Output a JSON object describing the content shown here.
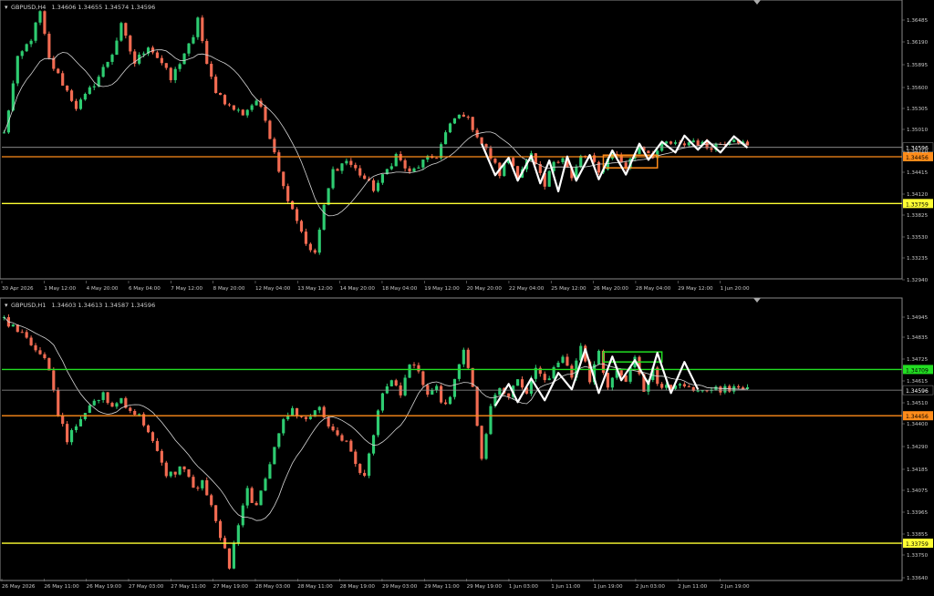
{
  "colors": {
    "background": "#000000",
    "bull": "#2ecc71",
    "bear": "#f26b52",
    "ma": "#d6d6d6",
    "axis_text": "#c8c8c8",
    "orange": "#ff8c1a",
    "yellow": "#ffff33",
    "green": "#22dd22",
    "zigzag": "#ffffff"
  },
  "chart_data": [
    {
      "type": "candlestick",
      "symbol_title": "GBPUSD,H4",
      "ohlc_text": "1.34606 1.34655 1.34574 1.34596",
      "ylim": [
        1.328,
        1.366
      ],
      "y_ticks": [
        "1.36485",
        "1.36190",
        "1.35895",
        "1.35600",
        "1.35305",
        "1.35010",
        "1.34710",
        "1.34415",
        "1.34120",
        "1.33825",
        "1.33530",
        "1.33235",
        "1.32940"
      ],
      "x_ticks": [
        "30 Apr 2026",
        "1 May 12:00",
        "4 May 20:00",
        "6 May 04:00",
        "7 May 12:00",
        "8 May 20:00",
        "12 May 04:00",
        "13 May 12:00",
        "14 May 20:00",
        "18 May 04:00",
        "19 May 12:00",
        "20 May 20:00",
        "22 May 04:00",
        "25 May 12:00",
        "26 May 20:00",
        "28 May 04:00",
        "29 May 12:00",
        "1 Jun 20:00"
      ],
      "levels": [
        {
          "label": "1.34456",
          "value": 1.34456,
          "color": "#ff8c1a"
        },
        {
          "label": "1.33759",
          "value": 1.33759,
          "color": "#ffff33"
        }
      ],
      "current_price": {
        "label": "1.34596",
        "value": 1.34596
      },
      "rectangle": {
        "t0": 133,
        "t1": 145,
        "p_top": 1.3448,
        "p_bottom": 1.3429,
        "color": "#ff8c1a"
      },
      "zigzag": [
        {
          "t": 106,
          "p": 1.3465
        },
        {
          "t": 109,
          "p": 1.3418
        },
        {
          "t": 112,
          "p": 1.3444
        },
        {
          "t": 114,
          "p": 1.341
        },
        {
          "t": 117,
          "p": 1.3447
        },
        {
          "t": 119,
          "p": 1.3406
        },
        {
          "t": 121,
          "p": 1.344
        },
        {
          "t": 123,
          "p": 1.3394
        },
        {
          "t": 125,
          "p": 1.3446
        },
        {
          "t": 127,
          "p": 1.341
        },
        {
          "t": 130,
          "p": 1.3448
        },
        {
          "t": 132,
          "p": 1.3412
        },
        {
          "t": 135,
          "p": 1.3455
        },
        {
          "t": 138,
          "p": 1.3419
        },
        {
          "t": 141,
          "p": 1.3465
        },
        {
          "t": 143,
          "p": 1.3441
        },
        {
          "t": 146,
          "p": 1.3468
        },
        {
          "t": 149,
          "p": 1.3452
        },
        {
          "t": 151,
          "p": 1.3477
        },
        {
          "t": 154,
          "p": 1.3456
        },
        {
          "t": 156,
          "p": 1.347
        },
        {
          "t": 159,
          "p": 1.3452
        },
        {
          "t": 162,
          "p": 1.3476
        },
        {
          "t": 165,
          "p": 1.3459
        }
      ],
      "waypoints": [
        [
          0,
          1.348
        ],
        [
          3,
          1.359
        ],
        [
          6,
          1.3622
        ],
        [
          8,
          1.366
        ],
        [
          10,
          1.359
        ],
        [
          13,
          1.3555
        ],
        [
          16,
          1.352
        ],
        [
          18,
          1.3535
        ],
        [
          21,
          1.3565
        ],
        [
          24,
          1.36
        ],
        [
          26,
          1.364
        ],
        [
          29,
          1.3585
        ],
        [
          32,
          1.3612
        ],
        [
          35,
          1.3585
        ],
        [
          37,
          1.356
        ],
        [
          40,
          1.36
        ],
        [
          42,
          1.362
        ],
        [
          43,
          1.3655
        ],
        [
          45,
          1.358
        ],
        [
          47,
          1.3545
        ],
        [
          50,
          1.352
        ],
        [
          53,
          1.351
        ],
        [
          56,
          1.353
        ],
        [
          58,
          1.35
        ],
        [
          60,
          1.3455
        ],
        [
          62,
          1.34
        ],
        [
          64,
          1.337
        ],
        [
          66,
          1.3335
        ],
        [
          68,
          1.3303
        ],
        [
          69,
          1.3303
        ],
        [
          71,
          1.337
        ],
        [
          73,
          1.3425
        ],
        [
          76,
          1.344
        ],
        [
          79,
          1.342
        ],
        [
          82,
          1.3398
        ],
        [
          84,
          1.3415
        ],
        [
          87,
          1.3448
        ],
        [
          90,
          1.342
        ],
        [
          93,
          1.3438
        ],
        [
          96,
          1.3447
        ],
        [
          98,
          1.348
        ],
        [
          100,
          1.3502
        ],
        [
          102,
          1.351
        ],
        [
          104,
          1.349
        ],
        [
          106,
          1.3465
        ],
        [
          108,
          1.3445
        ],
        [
          110,
          1.342
        ],
        [
          112,
          1.3445
        ],
        [
          114,
          1.342
        ],
        [
          117,
          1.3447
        ],
        [
          120,
          1.34
        ],
        [
          122,
          1.344
        ],
        [
          124,
          1.3446
        ],
        [
          126,
          1.3412
        ],
        [
          128,
          1.3445
        ],
        [
          130,
          1.3446
        ],
        [
          132,
          1.342
        ],
        [
          135,
          1.3453
        ],
        [
          138,
          1.343
        ],
        [
          141,
          1.3462
        ],
        [
          144,
          1.3448
        ],
        [
          147,
          1.3466
        ],
        [
          150,
          1.3462
        ],
        [
          153,
          1.347
        ],
        [
          156,
          1.346
        ],
        [
          159,
          1.3465
        ],
        [
          162,
          1.3475
        ],
        [
          165,
          1.346
        ]
      ]
    },
    {
      "type": "candlestick",
      "symbol_title": "GBPUSD,H1",
      "ohlc_text": "1.34603 1.34613 1.34587 1.34596",
      "ylim": [
        1.3357,
        1.3503
      ],
      "y_ticks": [
        "1.34945",
        "1.34835",
        "1.34725",
        "1.34615",
        "1.34510",
        "1.34400",
        "1.34290",
        "1.34185",
        "1.34075",
        "1.33965",
        "1.33855",
        "1.33750",
        "1.33640"
      ],
      "x_ticks": [
        "26 May 2026",
        "26 May 11:00",
        "26 May 19:00",
        "27 May 03:00",
        "27 May 11:00",
        "27 May 19:00",
        "28 May 03:00",
        "28 May 11:00",
        "28 May 19:00",
        "29 May 03:00",
        "29 May 11:00",
        "29 May 19:00",
        "1 Jun 03:00",
        "1 Jun 11:00",
        "1 Jun 19:00",
        "2 Jun 03:00",
        "2 Jun 11:00",
        "2 Jun 19:00"
      ],
      "levels": [
        {
          "label": "1.34709",
          "value": 1.34709,
          "color": "#22dd22"
        },
        {
          "label": "1.34456",
          "value": 1.34456,
          "color": "#ff8c1a"
        },
        {
          "label": "1.33759",
          "value": 1.33759,
          "color": "#ffff33"
        }
      ],
      "current_price": {
        "label": "1.34596",
        "value": 1.34596
      },
      "rectangle": {
        "t0": 133,
        "t1": 146,
        "p_top": 1.34805,
        "p_bottom": 1.3475,
        "color": "#22dd22"
      },
      "zigzag": [
        {
          "t": 109,
          "p": 1.3451
        },
        {
          "t": 112,
          "p": 1.3463
        },
        {
          "t": 114,
          "p": 1.3453
        },
        {
          "t": 117,
          "p": 1.3466
        },
        {
          "t": 120,
          "p": 1.3454
        },
        {
          "t": 123,
          "p": 1.3469
        },
        {
          "t": 126,
          "p": 1.346
        },
        {
          "t": 129,
          "p": 1.3482
        },
        {
          "t": 132,
          "p": 1.3458
        },
        {
          "t": 135,
          "p": 1.3478
        },
        {
          "t": 137,
          "p": 1.3465
        },
        {
          "t": 140,
          "p": 1.3476
        },
        {
          "t": 143,
          "p": 1.3463
        },
        {
          "t": 145,
          "p": 1.348
        },
        {
          "t": 148,
          "p": 1.3458
        },
        {
          "t": 151,
          "p": 1.3475
        },
        {
          "t": 154,
          "p": 1.346
        }
      ],
      "waypoints": [
        [
          0,
          1.3498
        ],
        [
          4,
          1.3492
        ],
        [
          8,
          1.348
        ],
        [
          10,
          1.347
        ],
        [
          12,
          1.3446
        ],
        [
          14,
          1.3433
        ],
        [
          16,
          1.344
        ],
        [
          18,
          1.3448
        ],
        [
          20,
          1.3452
        ],
        [
          22,
          1.3458
        ],
        [
          24,
          1.345
        ],
        [
          26,
          1.3455
        ],
        [
          28,
          1.3449
        ],
        [
          30,
          1.3445
        ],
        [
          32,
          1.3438
        ],
        [
          34,
          1.3425
        ],
        [
          36,
          1.3412
        ],
        [
          38,
          1.3415
        ],
        [
          40,
          1.3418
        ],
        [
          42,
          1.3405
        ],
        [
          44,
          1.341
        ],
        [
          46,
          1.3395
        ],
        [
          48,
          1.338
        ],
        [
          50,
          1.3363
        ],
        [
          52,
          1.3385
        ],
        [
          54,
          1.3405
        ],
        [
          56,
          1.3395
        ],
        [
          58,
          1.341
        ],
        [
          60,
          1.343
        ],
        [
          62,
          1.3445
        ],
        [
          64,
          1.3448
        ],
        [
          66,
          1.3444
        ],
        [
          68,
          1.3446
        ],
        [
          70,
          1.345
        ],
        [
          72,
          1.344
        ],
        [
          74,
          1.3436
        ],
        [
          76,
          1.343
        ],
        [
          78,
          1.342
        ],
        [
          80,
          1.3412
        ],
        [
          82,
          1.3435
        ],
        [
          84,
          1.346
        ],
        [
          86,
          1.3465
        ],
        [
          88,
          1.3455
        ],
        [
          90,
          1.3475
        ],
        [
          92,
          1.347
        ],
        [
          94,
          1.3455
        ],
        [
          96,
          1.346
        ],
        [
          98,
          1.345
        ],
        [
          100,
          1.3465
        ],
        [
          102,
          1.348
        ],
        [
          104,
          1.3462
        ],
        [
          106,
          1.342
        ],
        [
          108,
          1.345
        ],
        [
          110,
          1.3462
        ],
        [
          112,
          1.3455
        ],
        [
          114,
          1.3465
        ],
        [
          116,
          1.3458
        ],
        [
          118,
          1.347
        ],
        [
          120,
          1.3465
        ],
        [
          122,
          1.347
        ],
        [
          124,
          1.3478
        ],
        [
          126,
          1.3468
        ],
        [
          128,
          1.3482
        ],
        [
          130,
          1.3465
        ],
        [
          132,
          1.348
        ],
        [
          134,
          1.3462
        ],
        [
          136,
          1.347
        ],
        [
          138,
          1.3466
        ],
        [
          140,
          1.3478
        ],
        [
          142,
          1.346
        ],
        [
          144,
          1.347
        ],
        [
          146,
          1.346
        ],
        [
          148,
          1.3462
        ],
        [
          150,
          1.3461
        ],
        [
          152,
          1.346
        ],
        [
          154,
          1.346
        ]
      ]
    }
  ]
}
